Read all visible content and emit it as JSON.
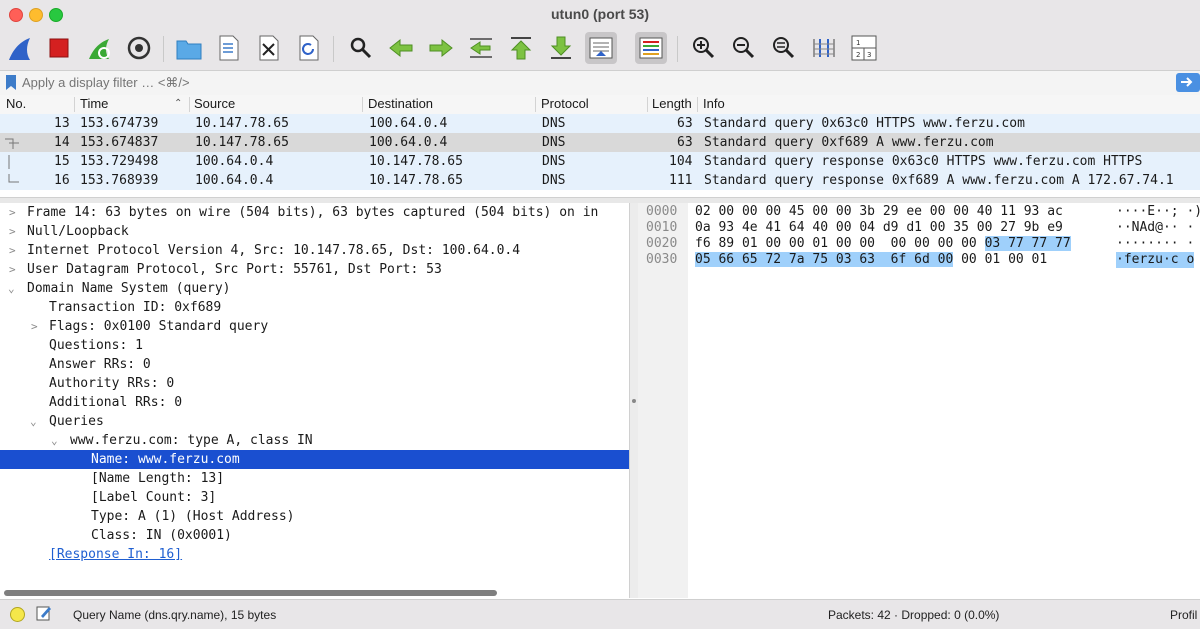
{
  "window": {
    "title": "utun0 (port 53)"
  },
  "filter": {
    "placeholder": "Apply a display filter … <⌘/>"
  },
  "packet_list": {
    "columns": [
      "No.",
      "Time",
      "Source",
      "Destination",
      "Protocol",
      "Length",
      "Info"
    ],
    "rows": [
      {
        "no": "13",
        "time": "153.674739",
        "source": "10.147.78.65",
        "destination": "100.64.0.4",
        "protocol": "DNS",
        "length": "63",
        "info": "Standard query 0x63c0 HTTPS www.ferzu.com"
      },
      {
        "no": "14",
        "time": "153.674837",
        "source": "10.147.78.65",
        "destination": "100.64.0.4",
        "protocol": "DNS",
        "length": "63",
        "info": "Standard query 0xf689 A www.ferzu.com"
      },
      {
        "no": "15",
        "time": "153.729498",
        "source": "100.64.0.4",
        "destination": "10.147.78.65",
        "protocol": "DNS",
        "length": "104",
        "info": "Standard query response 0x63c0 HTTPS www.ferzu.com HTTPS"
      },
      {
        "no": "16",
        "time": "153.768939",
        "source": "100.64.0.4",
        "destination": "10.147.78.65",
        "protocol": "DNS",
        "length": "111",
        "info": "Standard query response 0xf689 A www.ferzu.com A 172.67.74.1"
      }
    ]
  },
  "details": {
    "lines": [
      "Frame 14: 63 bytes on wire (504 bits), 63 bytes captured (504 bits) on in",
      "Null/Loopback",
      "Internet Protocol Version 4, Src: 10.147.78.65, Dst: 100.64.0.4",
      "User Datagram Protocol, Src Port: 55761, Dst Port: 53",
      "Domain Name System (query)",
      "Transaction ID: 0xf689",
      "Flags: 0x0100 Standard query",
      "Questions: 1",
      "Answer RRs: 0",
      "Authority RRs: 0",
      "Additional RRs: 0",
      "Queries",
      "www.ferzu.com: type A, class IN",
      "Name: www.ferzu.com",
      "[Name Length: 13]",
      "[Label Count: 3]",
      "Type: A (1) (Host Address)",
      "Class: IN (0x0001)",
      "[Response In: 16]"
    ]
  },
  "bytes": {
    "rows": [
      {
        "offset": "0000",
        "hex_a": "02 00 00 00 45 00 00 3b  29 ee 00 00 40 11 93 ac",
        "hex_hl": "",
        "hex_b": "",
        "ascii": "····E··; ·)",
        "ascii_hl": ""
      },
      {
        "offset": "0010",
        "hex_a": "0a 93 4e 41 64 40 00 04  d9 d1 00 35 00 27 9b e9",
        "hex_hl": "",
        "hex_b": "",
        "ascii": "··NAd@·· ·",
        "ascii_hl": ""
      },
      {
        "offset": "0020",
        "hex_a": "f6 89 01 00 00 01 00 00  00 00 00 00 ",
        "hex_hl": "03 77 77 77",
        "hex_b": "",
        "ascii": "········ ·",
        "ascii_hl": ""
      },
      {
        "offset": "0030",
        "hex_a": "",
        "hex_hl": "05 66 65 72 7a 75 03 63  6f 6d 00",
        "hex_b": " 00 01 00 01",
        "ascii": "",
        "ascii_hl": "·ferzu·c o"
      }
    ]
  },
  "status": {
    "field": "Query Name (dns.qry.name), 15 bytes",
    "packets": "Packets: 42 · Dropped: 0 (0.0%)",
    "profile": "Profil"
  },
  "colors": {
    "selection": "#1a4fd0",
    "byte_highlight": "#9fd0fb",
    "row_selected": "#d9d9d9",
    "row_dns": "#e6f1fc"
  }
}
